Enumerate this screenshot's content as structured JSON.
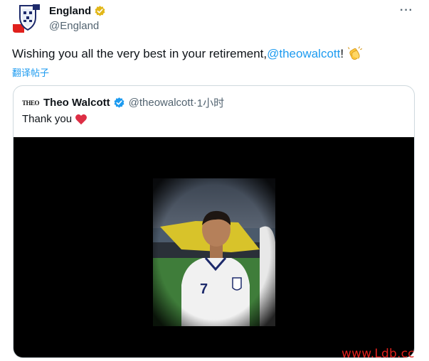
{
  "author": {
    "name": "England",
    "handle": "@England"
  },
  "tweet": {
    "text_prefix": "Wishing you all the very best in your retirement, ",
    "mention": "@theowalcott",
    "text_suffix": "!",
    "translate_label": "翻译帖子"
  },
  "quoted": {
    "logo_text": "THEO",
    "name": "Theo Walcott",
    "handle": "@theowalcott",
    "separator": " · ",
    "time": "1小时",
    "text": "Thank you"
  },
  "watermark": "www.Ldb.cc",
  "icons": {
    "avatar": "england-crest-icon",
    "verified_author": "gold-verified-badge-icon",
    "verified_quoted": "blue-verified-badge-icon",
    "more": "more-options-icon",
    "clap": "clapping-hands-icon",
    "heart": "red-heart-icon"
  },
  "colors": {
    "link": "#1d9bf0",
    "secondary_text": "#536471",
    "border": "#cfd9de",
    "gold_badge": "#e2b719",
    "blue_badge": "#1d9bf0",
    "heart": "#f91880",
    "watermark": "#e0201c"
  }
}
